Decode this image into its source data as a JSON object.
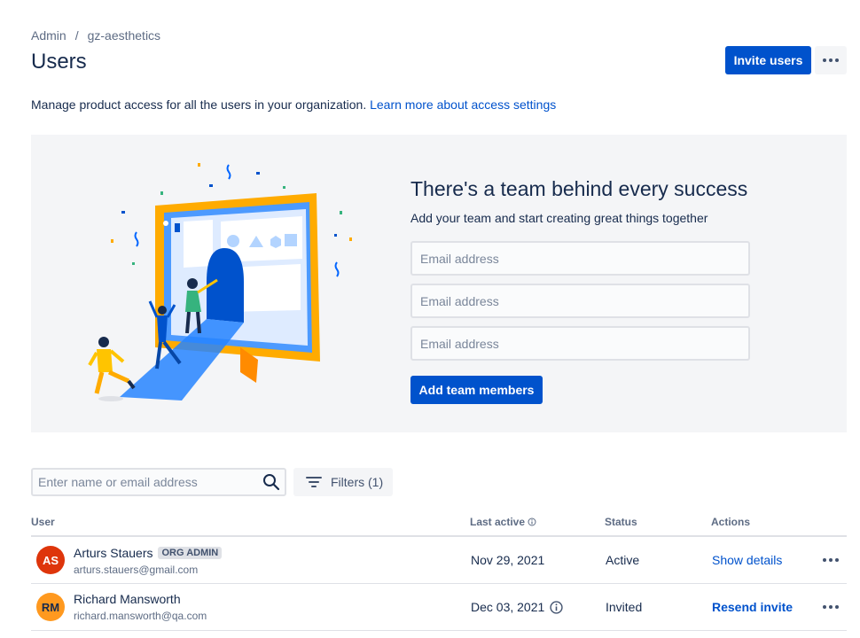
{
  "breadcrumb": [
    "Admin",
    "gz-aesthetics"
  ],
  "page_title": "Users",
  "header": {
    "invite_label": "Invite users"
  },
  "description": {
    "text": "Manage product access for all the users in your organization.",
    "link": "Learn more about access settings"
  },
  "promo": {
    "title": "There's a team behind every success",
    "subtitle": "Add your team and start creating great things together",
    "email_placeholder": "Email address",
    "add_label": "Add team members"
  },
  "search": {
    "placeholder": "Enter name or email address"
  },
  "filters_label": "Filters (1)",
  "table": {
    "headers": {
      "user": "User",
      "last_active": "Last active",
      "status": "Status",
      "actions": "Actions"
    },
    "rows": [
      {
        "initials": "AS",
        "avatar_color": "#de350b",
        "name": "Arturs Stauers",
        "badge": "ORG ADMIN",
        "email": "arturs.stauers@gmail.com",
        "last_active": "Nov 29, 2021",
        "status": "Active",
        "action": "Show details"
      },
      {
        "initials": "RM",
        "avatar_color": "#ff991f",
        "name": "Richard Mansworth",
        "badge": "",
        "email": "richard.mansworth@qa.com",
        "last_active": "Dec 03, 2021",
        "status": "Invited",
        "action": "Resend invite"
      }
    ]
  },
  "colors": {
    "primary": "#0052cc",
    "text": "#172b4d",
    "subtle": "#5e6c84",
    "panel_bg": "#f4f5f7"
  }
}
